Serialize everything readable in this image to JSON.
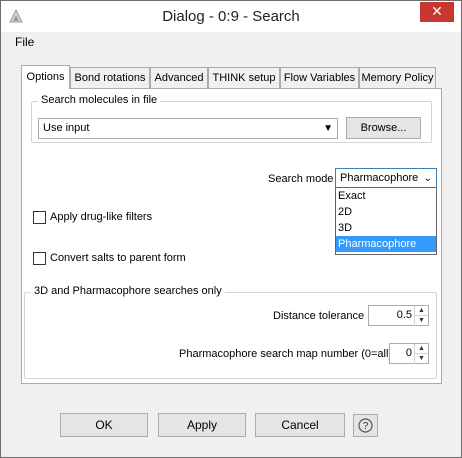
{
  "window": {
    "title": "Dialog - 0:9 - Search",
    "close_glyph": "✕"
  },
  "menu": {
    "file": "File"
  },
  "tabs": [
    {
      "label": "Options"
    },
    {
      "label": "Bond rotations"
    },
    {
      "label": "Advanced"
    },
    {
      "label": "THINK setup"
    },
    {
      "label": "Flow Variables"
    },
    {
      "label": "Memory Policy"
    }
  ],
  "search_file": {
    "group_title": "Search molecules in file",
    "combo_value": "Use input",
    "browse_label": "Browse..."
  },
  "search_mode": {
    "label": "Search mode",
    "value": "Pharmacophore",
    "options": [
      "Exact",
      "2D",
      "3D",
      "Pharmacophore"
    ],
    "selected_index": 3
  },
  "checkboxes": {
    "drug_like": {
      "label": "Apply drug-like filters",
      "checked": false
    },
    "salts": {
      "label": "Convert salts to parent form",
      "checked": false
    }
  },
  "pharm_group": {
    "title": "3D and Pharmacophore searches only",
    "distance_label": "Distance tolerance",
    "distance_value": "0.5",
    "map_label": "Pharmacophore search map number (0=all)",
    "map_value": "0"
  },
  "buttons": {
    "ok": "OK",
    "apply": "Apply",
    "cancel": "Cancel",
    "help_glyph": "?"
  },
  "icons": {
    "app": "app-icon",
    "chevron": "chevron-down-icon",
    "spin_up": "spinner-up-icon",
    "spin_down": "spinner-down-icon",
    "help": "help-icon"
  }
}
